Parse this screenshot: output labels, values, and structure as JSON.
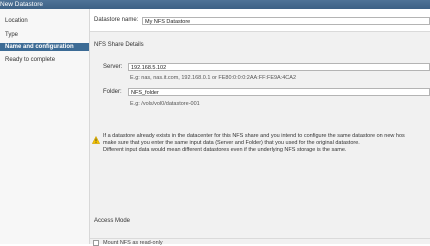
{
  "window": {
    "title": "New Datastore"
  },
  "steps": [
    {
      "num": "",
      "label": "Location"
    },
    {
      "num": "",
      "label": "Type"
    },
    {
      "num": "",
      "label": "Name and configuration"
    },
    {
      "num": "",
      "label": "Ready to complete"
    }
  ],
  "form": {
    "datastore_name_label": "Datastore name:",
    "datastore_name_value": "My NFS Datastore",
    "nfs_section_title": "NFS Share Details",
    "server_label": "Server:",
    "server_value": "192.168.5.102",
    "server_hint": "E.g: nas, nas.it.com, 192.168.0.1 or FE80:0:0:0:2AA:FF:FE9A:4CA2",
    "folder_label": "Folder:",
    "folder_value": "NFS_folder",
    "folder_hint": "E.g: /vols/vol0/datastore-001",
    "warning_line1": "If a datastore already exists in the datacenter for this NFS share and you intend to configure the same datastore on new hos",
    "warning_line2": "make sure that you enter the same input data (Server and Folder) that you used for the original datastore.",
    "warning_line3": "Different input data would mean different datastores even if the underlying NFS storage is the same.",
    "access_mode_title": "Access Mode",
    "mount_readonly_label": "Mount NFS as read-only",
    "mount_readonly_checked": false
  },
  "colors": {
    "titlebar": "#45698d",
    "active_step": "#3c6b95",
    "warning": "#f5c400"
  }
}
